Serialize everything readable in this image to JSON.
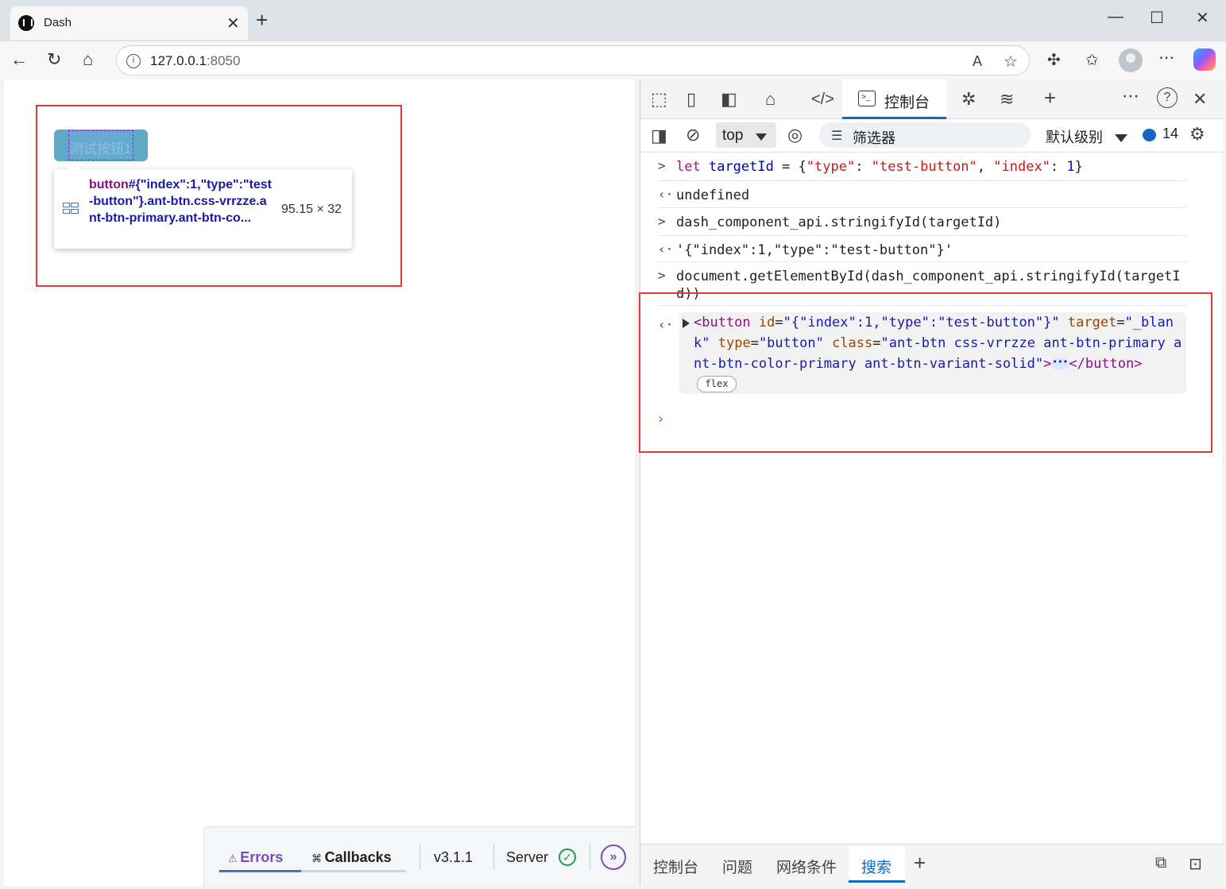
{
  "browser": {
    "tab_title": "Dash",
    "url_host": "127.0.0.1",
    "url_port": ":8050"
  },
  "page": {
    "button_label": "测试按钮1",
    "tooltip": {
      "selector_tag": "button",
      "selector_rest": "#{\"index\":1,\"type\":\"test-button\"}.ant-btn.css-vrrzze.ant-btn-primary.ant-btn-co...",
      "size": "95.15 × 32"
    },
    "dash_menu": {
      "errors": "Errors",
      "callbacks": "Callbacks",
      "version": "v3.1.1",
      "server": "Server"
    }
  },
  "devtools": {
    "active_tab": "控制台",
    "context": "top",
    "filter_placeholder": "筛选器",
    "level": "默认级别",
    "message_count": "14",
    "console": {
      "line1": "let targetId = {\"type\": \"test-button\", \"index\": 1}",
      "line1_parts": [
        "let",
        "targetId",
        " = {",
        "\"type\"",
        ": ",
        "\"test-button\"",
        ", ",
        "\"index\"",
        ": ",
        "1",
        "}"
      ],
      "line2": "undefined",
      "line3": "dash_component_api.stringifyId(targetId)",
      "line4": "'{\"index\":1,\"type\":\"test-button\"}'",
      "line5": "document.getElementById(dash_component_api.stringifyId(targetId))",
      "element": {
        "open_tag": "<button",
        "id_attr": "id",
        "id_val": "\"{\"index\":1,\"type\":\"test-button\"}\"",
        "target_attr": "target",
        "target_val": "\"_blank\"",
        "type_attr": "type",
        "type_val": "\"button\"",
        "class_attr": "class",
        "class_val": "\"ant-btn css-vrrzze ant-btn-primary ant-btn-color-primary ant-btn-variant-solid\"",
        "close": ">",
        "end_tag": "</button>",
        "badge": "flex"
      }
    },
    "drawer_tabs": [
      "控制台",
      "问题",
      "网络条件",
      "搜索"
    ]
  }
}
